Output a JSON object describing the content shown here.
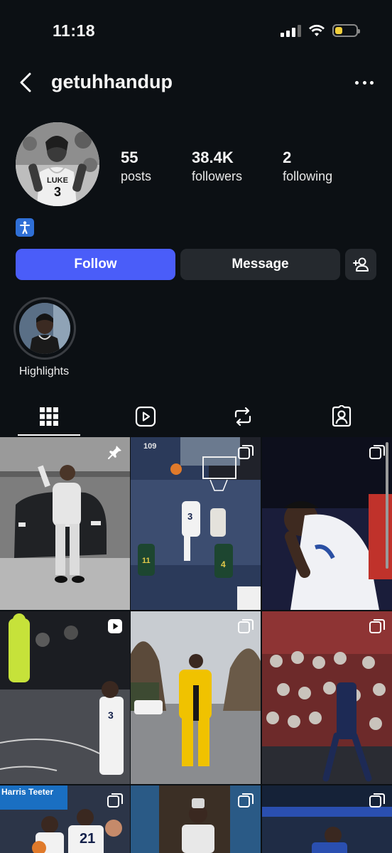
{
  "status_bar": {
    "time": "11:18",
    "battery_level": 0.35,
    "icons": [
      "cellular-signal-icon",
      "wifi-icon",
      "battery-icon"
    ]
  },
  "header": {
    "username": "getuhhandup",
    "back_icon": "chevron-left-icon",
    "more_icon": "more-dots-icon"
  },
  "profile": {
    "stats": [
      {
        "number": "55",
        "label": "posts"
      },
      {
        "number": "38.4K",
        "label": "followers"
      },
      {
        "number": "2",
        "label": "following"
      }
    ],
    "bio_icon": "person-standing-emoji-icon"
  },
  "actions": {
    "follow_label": "Follow",
    "message_label": "Message",
    "add_friend_icon": "add-person-icon",
    "follow_color": "#4a5df9"
  },
  "highlights": [
    {
      "label": "Highlights"
    }
  ],
  "tabs": [
    {
      "icon": "grid-icon",
      "active": true
    },
    {
      "icon": "reels-icon",
      "active": false
    },
    {
      "icon": "reposts-icon",
      "active": false
    },
    {
      "icon": "tagged-icon",
      "active": false
    }
  ],
  "posts": [
    {
      "type": "photo",
      "badge": "pin-icon"
    },
    {
      "type": "carousel",
      "badge": "carousel-icon"
    },
    {
      "type": "carousel",
      "badge": "carousel-icon"
    },
    {
      "type": "reel",
      "badge": "reel-icon"
    },
    {
      "type": "carousel",
      "badge": "carousel-icon"
    },
    {
      "type": "carousel",
      "badge": "carousel-icon"
    },
    {
      "type": "carousel",
      "badge": "carousel-icon"
    },
    {
      "type": "carousel",
      "badge": "carousel-icon"
    },
    {
      "type": "carousel",
      "badge": "carousel-icon"
    }
  ],
  "post_texts": {
    "banner_store": "Harris Teeter",
    "jersey_21": "21",
    "arena_number": "109",
    "jersey_3": "3",
    "jersey_11": "11",
    "jersey_4": "4"
  }
}
